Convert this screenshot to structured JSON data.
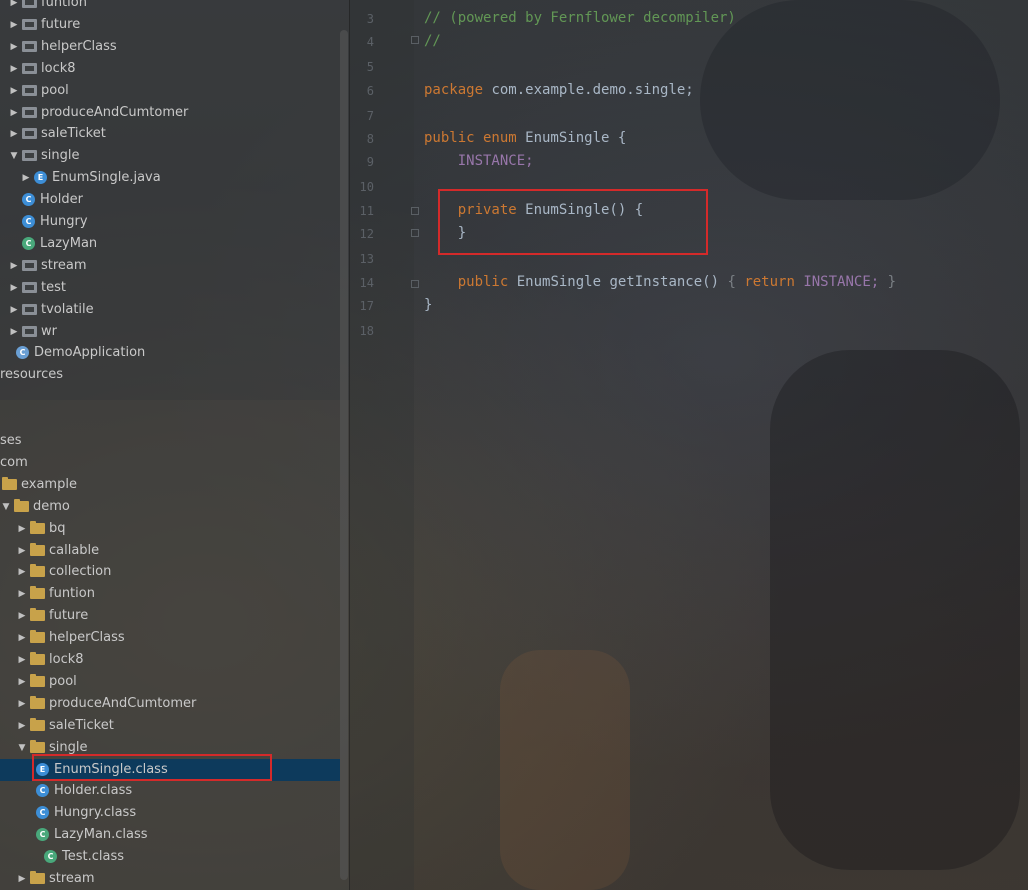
{
  "tree": {
    "source_rows": [
      {
        "label": "funtion",
        "type": "pkg",
        "arrow": "▶"
      },
      {
        "label": "future",
        "type": "pkg",
        "arrow": "▶"
      },
      {
        "label": "helperClass",
        "type": "pkg",
        "arrow": "▶"
      },
      {
        "label": "lock8",
        "type": "pkg",
        "arrow": "▶"
      },
      {
        "label": "pool",
        "type": "pkg",
        "arrow": "▶"
      },
      {
        "label": "produceAndCumtomer",
        "type": "pkg",
        "arrow": "▶"
      },
      {
        "label": "saleTicket",
        "type": "pkg",
        "arrow": "▶"
      },
      {
        "label": "single",
        "type": "pkg",
        "arrow": "▼"
      },
      {
        "label": "EnumSingle.java",
        "type": "enum",
        "arrow": "▶"
      },
      {
        "label": "Holder",
        "type": "class",
        "arrow": ""
      },
      {
        "label": "Hungry",
        "type": "class",
        "arrow": ""
      },
      {
        "label": "LazyMan",
        "type": "green",
        "arrow": ""
      },
      {
        "label": "stream",
        "type": "pkg",
        "arrow": "▶"
      },
      {
        "label": "test",
        "type": "pkg",
        "arrow": "▶"
      },
      {
        "label": "tvolatile",
        "type": "pkg",
        "arrow": "▶"
      },
      {
        "label": "wr",
        "type": "pkg",
        "arrow": "▶"
      },
      {
        "label": "DemoApplication",
        "type": "run",
        "arrow": ""
      },
      {
        "label": "resources",
        "type": "text",
        "arrow": ""
      }
    ],
    "target_rows": [
      {
        "label": "ses",
        "type": "text",
        "arrow": ""
      },
      {
        "label": "com",
        "type": "text",
        "arrow": ""
      },
      {
        "label": "example",
        "type": "folder",
        "arrow": ""
      },
      {
        "label": "demo",
        "type": "folder",
        "arrow": "▼"
      },
      {
        "label": "bq",
        "type": "folder",
        "arrow": "▶"
      },
      {
        "label": "callable",
        "type": "folder",
        "arrow": "▶"
      },
      {
        "label": "collection",
        "type": "folder",
        "arrow": "▶"
      },
      {
        "label": "funtion",
        "type": "folder",
        "arrow": "▶"
      },
      {
        "label": "future",
        "type": "folder",
        "arrow": "▶"
      },
      {
        "label": "helperClass",
        "type": "folder",
        "arrow": "▶"
      },
      {
        "label": "lock8",
        "type": "folder",
        "arrow": "▶"
      },
      {
        "label": "pool",
        "type": "folder",
        "arrow": "▶"
      },
      {
        "label": "produceAndCumtomer",
        "type": "folder",
        "arrow": "▶"
      },
      {
        "label": "saleTicket",
        "type": "folder",
        "arrow": "▶"
      },
      {
        "label": "single",
        "type": "folder",
        "arrow": "▼"
      },
      {
        "label": "EnumSingle.class",
        "type": "enum",
        "arrow": "",
        "selected": true
      },
      {
        "label": "Holder.class",
        "type": "class",
        "arrow": ""
      },
      {
        "label": "Hungry.class",
        "type": "class",
        "arrow": ""
      },
      {
        "label": "LazyMan.class",
        "type": "green",
        "arrow": ""
      },
      {
        "label": "Test.class",
        "type": "green",
        "arrow": ""
      },
      {
        "label": "stream",
        "type": "folder",
        "arrow": "▶"
      }
    ]
  },
  "editor": {
    "line_numbers": [
      "3",
      "4",
      "5",
      "6",
      "7",
      "8",
      "9",
      "10",
      "11",
      "12",
      "13",
      "14",
      "17",
      "18"
    ],
    "comment_line": "// (powered by Fernflower decompiler)",
    "comment_line2": "//",
    "package_kw": "package",
    "package_name": " com.example.demo.single;",
    "class_decl_kw": "public enum",
    "class_decl_name": " EnumSingle {",
    "instance_line": "    INSTANCE;",
    "ctor_kw": "    private",
    "ctor_rest": " EnumSingle() {",
    "ctor_close": "    }",
    "method_kw": "    public",
    "method_sig": " EnumSingle getInstance() ",
    "method_body_open": "{ ",
    "method_return_kw": "return",
    "method_return_val": " INSTANCE;",
    "method_body_close": " }",
    "class_close": "}"
  },
  "colors": {
    "keyword": "#cc7832",
    "comment": "#629755",
    "constant": "#9876aa",
    "highlight": "#d42a2a",
    "selection": "#0d3a5c"
  }
}
